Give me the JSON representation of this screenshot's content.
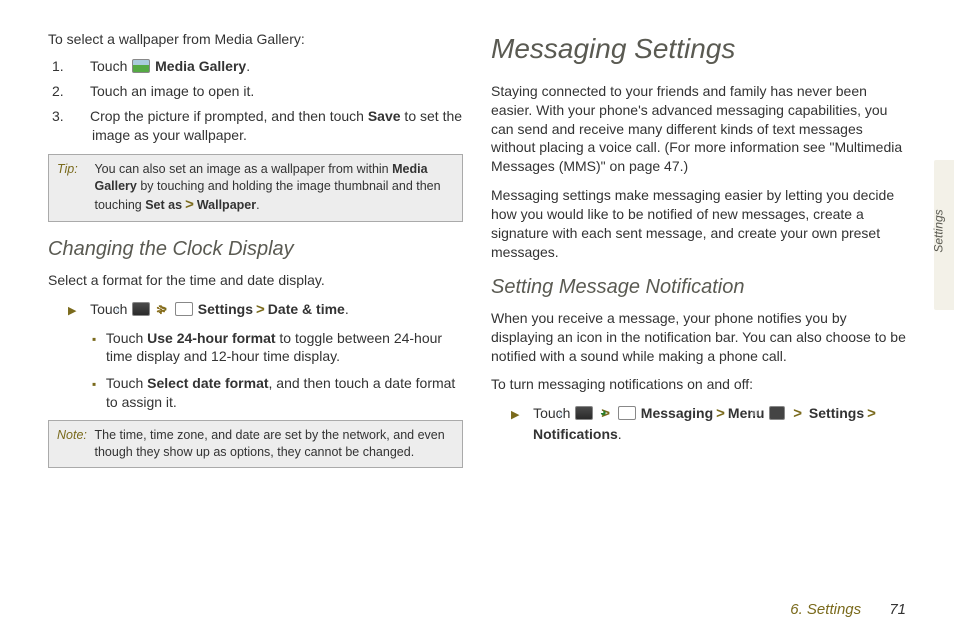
{
  "sidebar_tab": "Settings",
  "left": {
    "intro": "To select a wallpaper from Media Gallery:",
    "step1_prefix": "Touch ",
    "step1_bold": "Media Gallery",
    "step2": "Touch an image to open it.",
    "step3_a": "Crop the picture if prompted, and then touch ",
    "step3_bold": "Save",
    "step3_b": " to set the image as your wallpaper.",
    "tip_label": "Tip:",
    "tip_a": "You can also set an image as a wallpaper from within ",
    "tip_bold1": "Media Gallery",
    "tip_b": " by touching and holding the image thumbnail and then touching ",
    "tip_bold2": "Set as",
    "tip_gt": ">",
    "tip_bold3": "Wallpaper",
    "clock_heading": "Changing the Clock Display",
    "clock_intro": "Select a format for the time and date display.",
    "clock_touch": "Touch ",
    "clock_settings": "Settings",
    "clock_datetime": "Date & time",
    "clock_li1_a": "Touch ",
    "clock_li1_bold": "Use 24-hour format",
    "clock_li1_b": " to toggle between 24-hour time display and 12-hour time display.",
    "clock_li2_a": "Touch ",
    "clock_li2_bold": "Select date format",
    "clock_li2_b": ", and then touch a date format to assign it.",
    "note_label": "Note:",
    "note_body": "The time, time zone, and date are set by the network, and even though they show up as options, they cannot be changed."
  },
  "right": {
    "title": "Messaging Settings",
    "p1": "Staying connected to your friends and family has never been easier. With your phone's advanced messaging capabilities, you can send and receive many different kinds of text messages without placing a voice call. (For more information see \"Multimedia Messages (MMS)\" on page 47.)",
    "p2": "Messaging settings make messaging easier by letting you decide how you would like to be notified of new messages, create a signature with each sent message, and create your own preset messages.",
    "sub1": "Setting Message Notification",
    "sub1_p": "When you receive a message, your phone notifies you by displaying an icon in the notification bar. You can also choose to be notified with a sound while making a phone call.",
    "sub1_instr": "To turn messaging notifications on and off:",
    "touch": "Touch ",
    "messaging": "Messaging",
    "menu": "Menu",
    "settings": "Settings",
    "notifications": "Notifications"
  },
  "footer": {
    "chapter": "6. Settings",
    "page": "71"
  },
  "gt": ">"
}
